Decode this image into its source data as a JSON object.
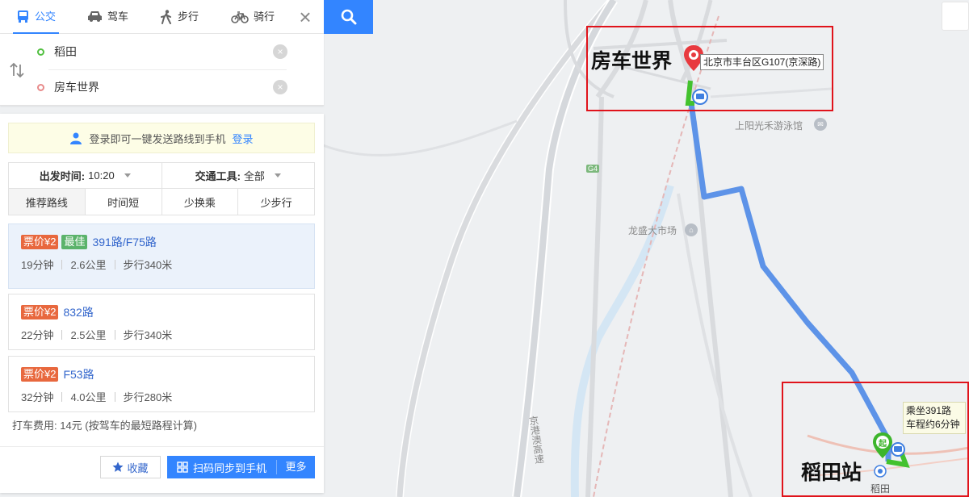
{
  "mode_tabs": [
    {
      "label": "公交",
      "icon": "bus-icon",
      "active": true
    },
    {
      "label": "驾车",
      "icon": "car-icon",
      "active": false
    },
    {
      "label": "步行",
      "icon": "walk-icon",
      "active": false
    },
    {
      "label": "骑行",
      "icon": "bike-icon",
      "active": false
    }
  ],
  "inputs": {
    "origin": "稻田",
    "destination": "房车世界"
  },
  "login_bar": {
    "text": "登录即可一键发送路线到手机",
    "link": "登录"
  },
  "filters": {
    "depart_label": "出发时间:",
    "depart_value": "10:20",
    "transport_label": "交通工具:",
    "transport_value": "全部",
    "sort_tabs": [
      "推荐路线",
      "时间短",
      "少换乘",
      "少步行"
    ]
  },
  "plans": [
    {
      "price": "票价¥2",
      "best": "最佳",
      "route": "391路/F75路",
      "duration": "19分钟",
      "distance": "2.6公里",
      "walk": "步行340米"
    },
    {
      "price": "票价¥2",
      "best": "",
      "route": "832路",
      "duration": "22分钟",
      "distance": "2.5公里",
      "walk": "步行340米"
    },
    {
      "price": "票价¥2",
      "best": "",
      "route": "F53路",
      "duration": "32分钟",
      "distance": "4.0公里",
      "walk": "步行280米"
    }
  ],
  "taxi_fare": "打车费用: 14元 (按驾车的最短路程计算)",
  "footer": {
    "favorite": "收藏",
    "sync": "扫码同步到手机",
    "more": "更多"
  },
  "map": {
    "destination_title": "房车世界",
    "destination_address": "北京市丰台区G107(京深路)",
    "origin_title": "稻田站",
    "origin_marker": "起",
    "origin_station": "稻田",
    "ride_tip": "乘坐391路 车程约6分钟",
    "labels": {
      "pool": "上阳光禾游泳馆",
      "market": "龙盛大市场",
      "highway": "京港澳高速",
      "road_shield": "G4"
    },
    "route_color": "#5d93e8",
    "walk_color": "#43c22e",
    "annotation_color": "#e0131b"
  }
}
